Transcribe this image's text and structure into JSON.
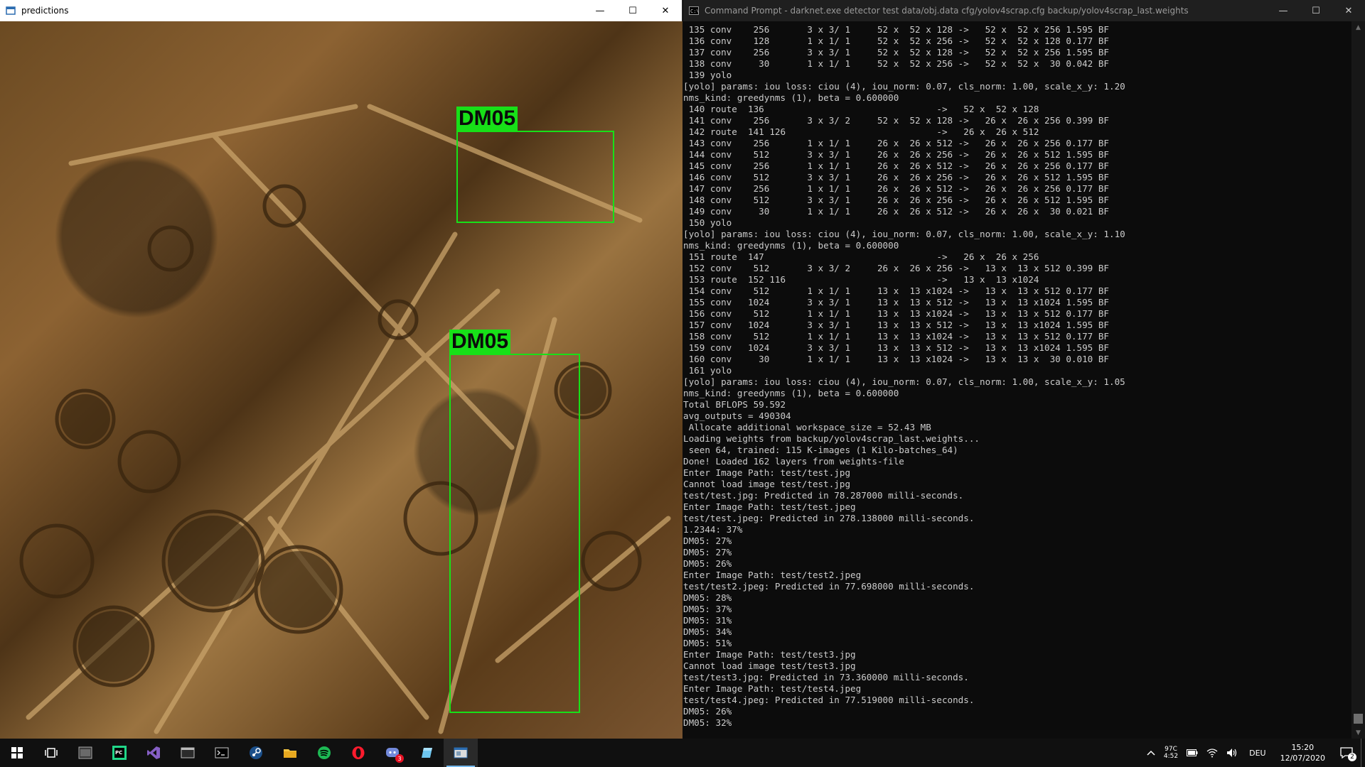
{
  "prediction_window": {
    "title": "predictions",
    "detections": [
      {
        "label": "DM05"
      },
      {
        "label": "DM05"
      }
    ]
  },
  "console_window": {
    "title": "Command Prompt - darknet.exe  detector test data/obj.data cfg/yolov4scrap.cfg backup/yolov4scrap_last.weights",
    "lines": [
      " 135 conv    256       3 x 3/ 1     52 x  52 x 128 ->   52 x  52 x 256 1.595 BF",
      " 136 conv    128       1 x 1/ 1     52 x  52 x 256 ->   52 x  52 x 128 0.177 BF",
      " 137 conv    256       3 x 3/ 1     52 x  52 x 128 ->   52 x  52 x 256 1.595 BF",
      " 138 conv     30       1 x 1/ 1     52 x  52 x 256 ->   52 x  52 x  30 0.042 BF",
      " 139 yolo",
      "[yolo] params: iou loss: ciou (4), iou_norm: 0.07, cls_norm: 1.00, scale_x_y: 1.20",
      "nms_kind: greedynms (1), beta = 0.600000",
      " 140 route  136                                ->   52 x  52 x 128",
      " 141 conv    256       3 x 3/ 2     52 x  52 x 128 ->   26 x  26 x 256 0.399 BF",
      " 142 route  141 126                            ->   26 x  26 x 512",
      " 143 conv    256       1 x 1/ 1     26 x  26 x 512 ->   26 x  26 x 256 0.177 BF",
      " 144 conv    512       3 x 3/ 1     26 x  26 x 256 ->   26 x  26 x 512 1.595 BF",
      " 145 conv    256       1 x 1/ 1     26 x  26 x 512 ->   26 x  26 x 256 0.177 BF",
      " 146 conv    512       3 x 3/ 1     26 x  26 x 256 ->   26 x  26 x 512 1.595 BF",
      " 147 conv    256       1 x 1/ 1     26 x  26 x 512 ->   26 x  26 x 256 0.177 BF",
      " 148 conv    512       3 x 3/ 1     26 x  26 x 256 ->   26 x  26 x 512 1.595 BF",
      " 149 conv     30       1 x 1/ 1     26 x  26 x 512 ->   26 x  26 x  30 0.021 BF",
      " 150 yolo",
      "[yolo] params: iou loss: ciou (4), iou_norm: 0.07, cls_norm: 1.00, scale_x_y: 1.10",
      "nms_kind: greedynms (1), beta = 0.600000",
      " 151 route  147                                ->   26 x  26 x 256",
      " 152 conv    512       3 x 3/ 2     26 x  26 x 256 ->   13 x  13 x 512 0.399 BF",
      " 153 route  152 116                            ->   13 x  13 x1024",
      " 154 conv    512       1 x 1/ 1     13 x  13 x1024 ->   13 x  13 x 512 0.177 BF",
      " 155 conv   1024       3 x 3/ 1     13 x  13 x 512 ->   13 x  13 x1024 1.595 BF",
      " 156 conv    512       1 x 1/ 1     13 x  13 x1024 ->   13 x  13 x 512 0.177 BF",
      " 157 conv   1024       3 x 3/ 1     13 x  13 x 512 ->   13 x  13 x1024 1.595 BF",
      " 158 conv    512       1 x 1/ 1     13 x  13 x1024 ->   13 x  13 x 512 0.177 BF",
      " 159 conv   1024       3 x 3/ 1     13 x  13 x 512 ->   13 x  13 x1024 1.595 BF",
      " 160 conv     30       1 x 1/ 1     13 x  13 x1024 ->   13 x  13 x  30 0.010 BF",
      " 161 yolo",
      "[yolo] params: iou loss: ciou (4), iou_norm: 0.07, cls_norm: 1.00, scale_x_y: 1.05",
      "nms_kind: greedynms (1), beta = 0.600000",
      "Total BFLOPS 59.592",
      "avg_outputs = 490304",
      " Allocate additional workspace_size = 52.43 MB",
      "Loading weights from backup/yolov4scrap_last.weights...",
      " seen 64, trained: 115 K-images (1 Kilo-batches_64)",
      "Done! Loaded 162 layers from weights-file",
      "Enter Image Path: test/test.jpg",
      "Cannot load image test/test.jpg",
      "test/test.jpg: Predicted in 78.287000 milli-seconds.",
      "Enter Image Path: test/test.jpeg",
      "test/test.jpeg: Predicted in 278.138000 milli-seconds.",
      "1.2344: 37%",
      "DM05: 27%",
      "DM05: 27%",
      "DM05: 26%",
      "Enter Image Path: test/test2.jpeg",
      "test/test2.jpeg: Predicted in 77.698000 milli-seconds.",
      "DM05: 28%",
      "DM05: 37%",
      "DM05: 31%",
      "DM05: 34%",
      "DM05: 51%",
      "Enter Image Path: test/test3.jpg",
      "Cannot load image test/test3.jpg",
      "test/test3.jpg: Predicted in 73.360000 milli-seconds.",
      "Enter Image Path: test/test4.jpeg",
      "test/test4.jpeg: Predicted in 77.519000 milli-seconds.",
      "DM05: 26%",
      "DM05: 32%"
    ]
  },
  "taskbar": {
    "apps": [
      "start-icon",
      "task-view-icon",
      "app-window-icon",
      "pycharm-icon",
      "visual-studio-icon",
      "explorer-window-icon",
      "terminal-icon",
      "steam-icon",
      "file-explorer-icon",
      "spotify-icon",
      "opera-icon",
      "discord-icon",
      "notes-icon",
      "predictions-window-icon"
    ],
    "discord_badge": "3",
    "tray": {
      "language": "DEU",
      "time": "15:20",
      "date": "12/07/2020",
      "cpu_top": "97C",
      "cpu_bottom": "4:52",
      "notifications": "2"
    }
  },
  "colors": {
    "detection": "#18e018",
    "console_text": "#cccccc",
    "console_bg": "#0c0c0c"
  }
}
